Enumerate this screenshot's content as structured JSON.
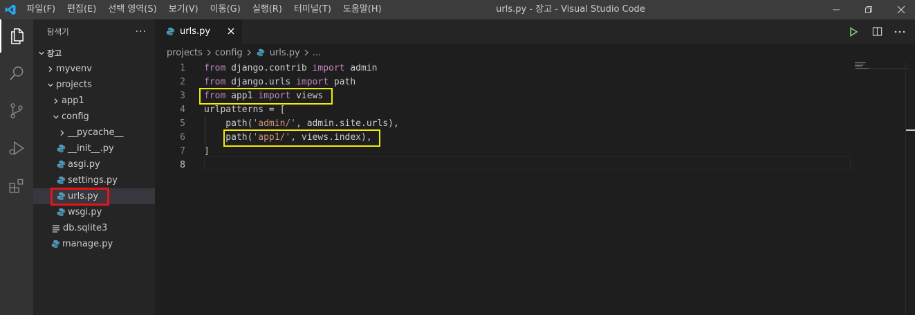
{
  "titlebar": {
    "menu": [
      "파일(F)",
      "편집(E)",
      "선택 영역(S)",
      "보기(V)",
      "이동(G)",
      "실행(R)",
      "터미널(T)",
      "도움말(H)"
    ],
    "window_title": "urls.py - 장고 - Visual Studio Code"
  },
  "sidebar": {
    "title": "탐색기",
    "more": "···",
    "root": "장고",
    "items": [
      {
        "label": "myvenv",
        "kind": "folder",
        "state": "collapsed"
      },
      {
        "label": "projects",
        "kind": "folder",
        "state": "expanded"
      },
      {
        "label": "app1",
        "kind": "folder",
        "state": "collapsed"
      },
      {
        "label": "config",
        "kind": "folder",
        "state": "expanded"
      },
      {
        "label": "__pycache__",
        "kind": "folder",
        "state": "collapsed"
      },
      {
        "label": "__init__.py",
        "kind": "python-file"
      },
      {
        "label": "asgi.py",
        "kind": "python-file"
      },
      {
        "label": "settings.py",
        "kind": "python-file"
      },
      {
        "label": "urls.py",
        "kind": "python-file",
        "selected": true
      },
      {
        "label": "wsgi.py",
        "kind": "python-file"
      },
      {
        "label": "db.sqlite3",
        "kind": "text-file"
      },
      {
        "label": "manage.py",
        "kind": "python-file"
      }
    ]
  },
  "tab": {
    "label": "urls.py",
    "close": "✕"
  },
  "breadcrumb": {
    "parts": [
      "projects",
      "config",
      "urls.py",
      "..."
    ]
  },
  "editor": {
    "line_numbers": [
      "1",
      "2",
      "3",
      "4",
      "5",
      "6",
      "7",
      "8"
    ],
    "current_line": 8,
    "lines": [
      [
        {
          "t": "from",
          "c": "kw"
        },
        {
          "t": " django.contrib "
        },
        {
          "t": "import",
          "c": "kw"
        },
        {
          "t": " admin"
        }
      ],
      [
        {
          "t": "from",
          "c": "kw"
        },
        {
          "t": " django.urls "
        },
        {
          "t": "import",
          "c": "kw"
        },
        {
          "t": " path"
        }
      ],
      [
        {
          "t": "from",
          "c": "kw"
        },
        {
          "t": " app1 "
        },
        {
          "t": "import",
          "c": "kw"
        },
        {
          "t": " views"
        }
      ],
      [
        {
          "t": "urlpatterns = ["
        }
      ],
      [
        {
          "t": "    path("
        },
        {
          "t": "'admin/'",
          "c": "str"
        },
        {
          "t": ", admin.site.urls),"
        }
      ],
      [
        {
          "t": "    path("
        },
        {
          "t": "'app1/'",
          "c": "str"
        },
        {
          "t": ", views.index),"
        }
      ],
      [
        {
          "t": "]"
        }
      ],
      []
    ]
  },
  "colors": {
    "keyword": "#c586c0",
    "string": "#ce9178",
    "highlight_box": "#f2ec0b",
    "selection_box": "#e8141a",
    "vscode_blue": "#23a9f2",
    "python_blue": "#519aba",
    "run_green": "#89d185"
  }
}
